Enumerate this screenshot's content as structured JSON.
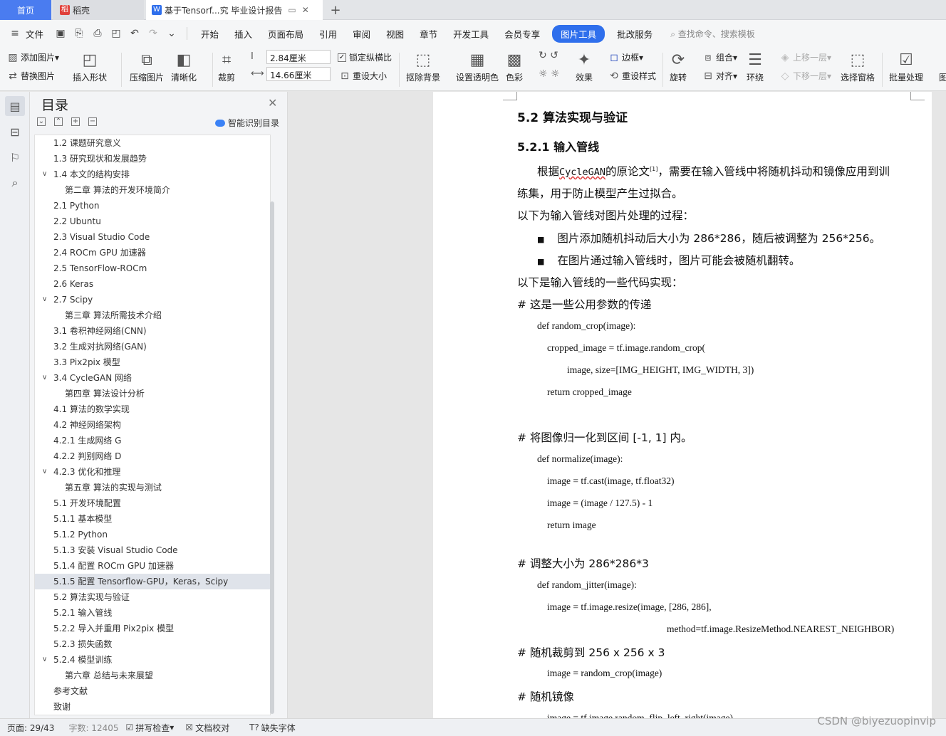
{
  "tabs": {
    "home": "首页",
    "doc1": "稻壳",
    "active": "基于Tensorf...究 毕业设计报告"
  },
  "menu": {
    "file": "文件",
    "items": [
      "开始",
      "插入",
      "页面布局",
      "引用",
      "审阅",
      "视图",
      "章节",
      "开发工具",
      "会员专享"
    ],
    "active": "图片工具",
    "extra": "批改服务",
    "search": "查找命令、搜索模板"
  },
  "ribbon": {
    "add_image": "添加图片",
    "replace_image": "替换图片",
    "insert_shape": "插入形状",
    "compress": "压缩图片",
    "sharpen": "清晰化",
    "crop": "裁剪",
    "height": "2.84厘米",
    "width": "14.66厘米",
    "lock_ratio": "锁定纵横比",
    "reset_size": "重设大小",
    "remove_bg": "抠除背景",
    "transparent": "设置透明色",
    "color": "色彩",
    "effects": "效果",
    "border": "边框",
    "reset_style": "重设样式",
    "rotate": "旋转",
    "group": "组合",
    "align": "对齐",
    "wrap": "环绕",
    "bring_forward": "上移一层",
    "send_backward": "下移一层",
    "select_pane": "选择窗格",
    "batch": "批量处理",
    "more": "图"
  },
  "toc": {
    "title": "目录",
    "smart": "智能识别目录",
    "items": [
      {
        "label": "1.2  课题研究意义",
        "indent": 1,
        "arrow": ""
      },
      {
        "label": "1.3  研究现状和发展趋势",
        "indent": 1,
        "arrow": ""
      },
      {
        "label": "1.4  本文的结构安排",
        "indent": 1,
        "arrow": "∨"
      },
      {
        "label": "第二章  算法的开发环境简介",
        "indent": 2,
        "arrow": ""
      },
      {
        "label": "2.1 Python",
        "indent": 1,
        "arrow": ""
      },
      {
        "label": "2.2 Ubuntu",
        "indent": 1,
        "arrow": ""
      },
      {
        "label": "2.3 Visual Studio Code",
        "indent": 1,
        "arrow": ""
      },
      {
        "label": "2.4 ROCm GPU 加速器",
        "indent": 1,
        "arrow": ""
      },
      {
        "label": "2.5 TensorFlow-ROCm",
        "indent": 1,
        "arrow": ""
      },
      {
        "label": "2.6 Keras",
        "indent": 1,
        "arrow": ""
      },
      {
        "label": "2.7 Scipy",
        "indent": 1,
        "arrow": "∨"
      },
      {
        "label": "第三章  算法所需技术介绍",
        "indent": 2,
        "arrow": ""
      },
      {
        "label": "3.1  卷积神经网络(CNN)",
        "indent": 1,
        "arrow": ""
      },
      {
        "label": "3.2  生成对抗网络(GAN)",
        "indent": 1,
        "arrow": ""
      },
      {
        "label": "3.3 Pix2pix 模型",
        "indent": 1,
        "arrow": ""
      },
      {
        "label": "3.4 CycleGAN 网络",
        "indent": 1,
        "arrow": "∨"
      },
      {
        "label": "第四章  算法设计分析",
        "indent": 2,
        "arrow": ""
      },
      {
        "label": "4.1  算法的数学实现",
        "indent": 1,
        "arrow": ""
      },
      {
        "label": "4.2  神经网络架构",
        "indent": 1,
        "arrow": ""
      },
      {
        "label": "4.2.1  生成网络 G",
        "indent": 1,
        "arrow": ""
      },
      {
        "label": "4.2.2  判别网络  D",
        "indent": 1,
        "arrow": ""
      },
      {
        "label": "4.2.3  优化和推理",
        "indent": 1,
        "arrow": "∨"
      },
      {
        "label": "第五章  算法的实现与测试",
        "indent": 2,
        "arrow": ""
      },
      {
        "label": "5.1  开发环境配置",
        "indent": 1,
        "arrow": ""
      },
      {
        "label": "5.1.1  基本模型",
        "indent": 1,
        "arrow": ""
      },
      {
        "label": "5.1.2 Python",
        "indent": 1,
        "arrow": ""
      },
      {
        "label": "5.1.3  安装 Visual Studio Code",
        "indent": 1,
        "arrow": ""
      },
      {
        "label": "5.1.4  配置 ROCm GPU 加速器",
        "indent": 1,
        "arrow": ""
      },
      {
        "label": "5.1.5  配置 Tensorflow-GPU，Keras，Scipy",
        "indent": 1,
        "arrow": "",
        "selected": true
      },
      {
        "label": "5.2  算法实现与验证",
        "indent": 1,
        "arrow": ""
      },
      {
        "label": "5.2.1  输入管线",
        "indent": 1,
        "arrow": ""
      },
      {
        "label": "5.2.2  导入并重用  Pix2pix  模型",
        "indent": 1,
        "arrow": ""
      },
      {
        "label": "5.2.3  损失函数",
        "indent": 1,
        "arrow": ""
      },
      {
        "label": "5.2.4  模型训练",
        "indent": 1,
        "arrow": "∨"
      },
      {
        "label": "第六章  总结与未来展望",
        "indent": 2,
        "arrow": ""
      },
      {
        "label": "参考文献",
        "indent": 1,
        "arrow": ""
      },
      {
        "label": "致谢",
        "indent": 1,
        "arrow": ""
      }
    ]
  },
  "doc": {
    "h2": "5.2  算法实现与验证",
    "h3": "5.2.1  输入管线",
    "p1a": "根据",
    "p1b": "CycleGAN",
    "p1c": "的原论文",
    "p1sup": "[1]",
    "p1d": "，需要在输入管线中将随机抖动和镜像应用到训",
    "p2": "练集，用于防止模型产生过拟合。",
    "p3": "以下为输入管线对图片处理的过程：",
    "b1": "图片添加随机抖动后大小为 286*286，随后被调整为 256*256。",
    "b2": "在图片通过输入管线时，图片可能会被随机翻转。",
    "p4": "以下是输入管线的一些代码实现：",
    "c1": "# 这是一些公用参数的传递",
    "k1": "def random_crop(image):",
    "k2": "cropped_image = tf.image.random_crop(",
    "k3": "image, size=[IMG_HEIGHT, IMG_WIDTH, 3])",
    "k4": "return cropped_image",
    "c2": "# 将图像归一化到区间 [-1, 1] 内。",
    "k5": "def normalize(image):",
    "k6": "image = tf.cast(image, tf.float32)",
    "k7": "image = (image / 127.5) - 1",
    "k8": "return image",
    "c3": "# 调整大小为 286*286*3",
    "k9": "def random_jitter(image):",
    "k10": "image = tf.image.resize(image, [286, 286],",
    "k11": "method=tf.image.ResizeMethod.NEAREST_NEIGHBOR)",
    "c4": "# 随机裁剪到  256 x 256 x 3",
    "k12": "image = random_crop(image)",
    "c5": "# 随机镜像",
    "k13": "image = tf.image.random_flip_left_right(image)"
  },
  "status": {
    "page": "页面: 29/43",
    "words": "字数: 12405",
    "spell": "拼写检查",
    "proof": "文档校对",
    "font": "缺失字体"
  },
  "watermark": "CSDN @biyezuopinvip"
}
